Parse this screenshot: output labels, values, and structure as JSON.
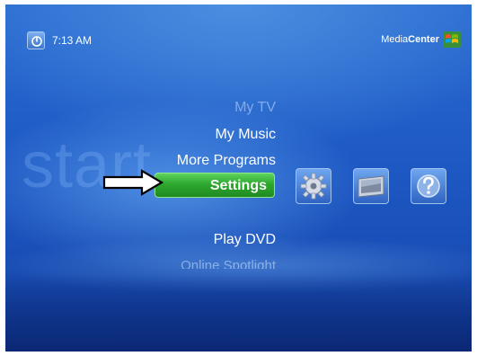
{
  "header": {
    "time": "7:13 AM",
    "brand_light": "Media",
    "brand_bold": "Center"
  },
  "background_word": "start",
  "menu": {
    "items": [
      {
        "label": "My TV"
      },
      {
        "label": "My Music"
      },
      {
        "label": "More Programs"
      },
      {
        "label": "Settings",
        "selected": true
      },
      {
        "label": "Play DVD"
      },
      {
        "label": "Online Spotlight"
      }
    ]
  },
  "tiles": [
    {
      "icon": "gear-icon"
    },
    {
      "icon": "monitor-icon"
    },
    {
      "icon": "help-icon"
    }
  ],
  "colors": {
    "background": "#1e59c4",
    "selection": "#2ea82e",
    "text": "#ffffff"
  }
}
